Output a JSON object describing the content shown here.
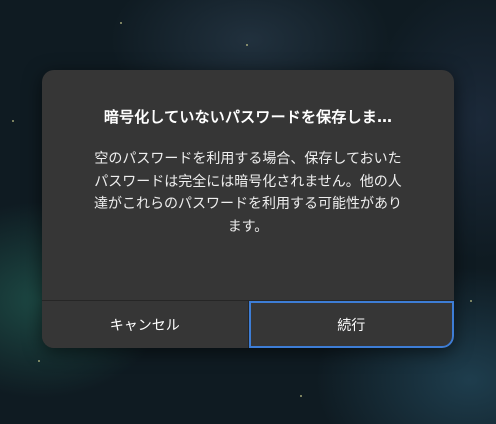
{
  "dialog": {
    "title": "暗号化していないパスワードを保存しま…",
    "message": "空のパスワードを利用する場合、保存しておいた\nパスワードは完全には暗号化されません。他の人\n達がこれらのパスワードを利用する可能性があり\nます。",
    "cancel_label": "キャンセル",
    "continue_label": "続行"
  }
}
